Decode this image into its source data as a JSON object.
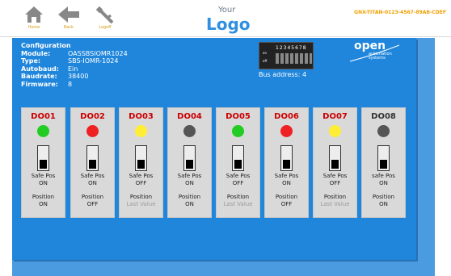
{
  "toolbar": {
    "home_label": "Home",
    "back_label": "Back",
    "logoff_label": "Logoff"
  },
  "logo": {
    "small": "Your",
    "big": "Logo"
  },
  "serial": "GNX-TITAN-0123-4567-89AB-CDEF",
  "config": {
    "title": "Configuration",
    "rows": [
      {
        "key": "Module:",
        "value": "OASSBSIOMR1024"
      },
      {
        "key": "Type:",
        "value": "SBS-IOMR-1024"
      },
      {
        "key": "Autobaud:",
        "value": "Ein"
      },
      {
        "key": "Baudrate:",
        "value": "38400"
      },
      {
        "key": "Firmware:",
        "value": "8"
      }
    ]
  },
  "dip": {
    "numbers": "12345678",
    "on_label": "on",
    "off_label": "off"
  },
  "bus_address": "Bus address: 4",
  "brand": {
    "open": "open",
    "line1": "automation",
    "line2": "systems"
  },
  "colors": {
    "green": "#22cc22",
    "red": "#ee2222",
    "yellow": "#ffee33",
    "gray": "#555555"
  },
  "outputs": [
    {
      "name": "DO01",
      "led": "green",
      "safe_label": "Safe Pos",
      "safe_value": "ON",
      "pos_label": "Position",
      "pos_value": "ON",
      "pos_dim": false
    },
    {
      "name": "DO02",
      "led": "red",
      "safe_label": "Safe Pos",
      "safe_value": "ON",
      "pos_label": "Position",
      "pos_value": "OFF",
      "pos_dim": false
    },
    {
      "name": "DO03",
      "led": "yellow",
      "safe_label": "Safe Pos",
      "safe_value": "OFF",
      "pos_label": "Position",
      "pos_value": "Last Value",
      "pos_dim": true
    },
    {
      "name": "DO04",
      "led": "gray",
      "safe_label": "Safe Pos",
      "safe_value": "ON",
      "pos_label": "Position",
      "pos_value": "ON",
      "pos_dim": false
    },
    {
      "name": "DO05",
      "led": "green",
      "safe_label": "Safe Pos",
      "safe_value": "OFF",
      "pos_label": "Position",
      "pos_value": "Last Value",
      "pos_dim": true
    },
    {
      "name": "DO06",
      "led": "red",
      "safe_label": "Safe Pos",
      "safe_value": "ON",
      "pos_label": "Position",
      "pos_value": "OFF",
      "pos_dim": false
    },
    {
      "name": "DO07",
      "led": "yellow",
      "safe_label": "Safe Pos",
      "safe_value": "OFF",
      "pos_label": "Position",
      "pos_value": "Last Value",
      "pos_dim": true
    },
    {
      "name": "DO08",
      "led": "gray",
      "safe_label": "safe Pos",
      "safe_value": "ON",
      "pos_label": "Position",
      "pos_value": "ON",
      "pos_dim": false
    }
  ]
}
